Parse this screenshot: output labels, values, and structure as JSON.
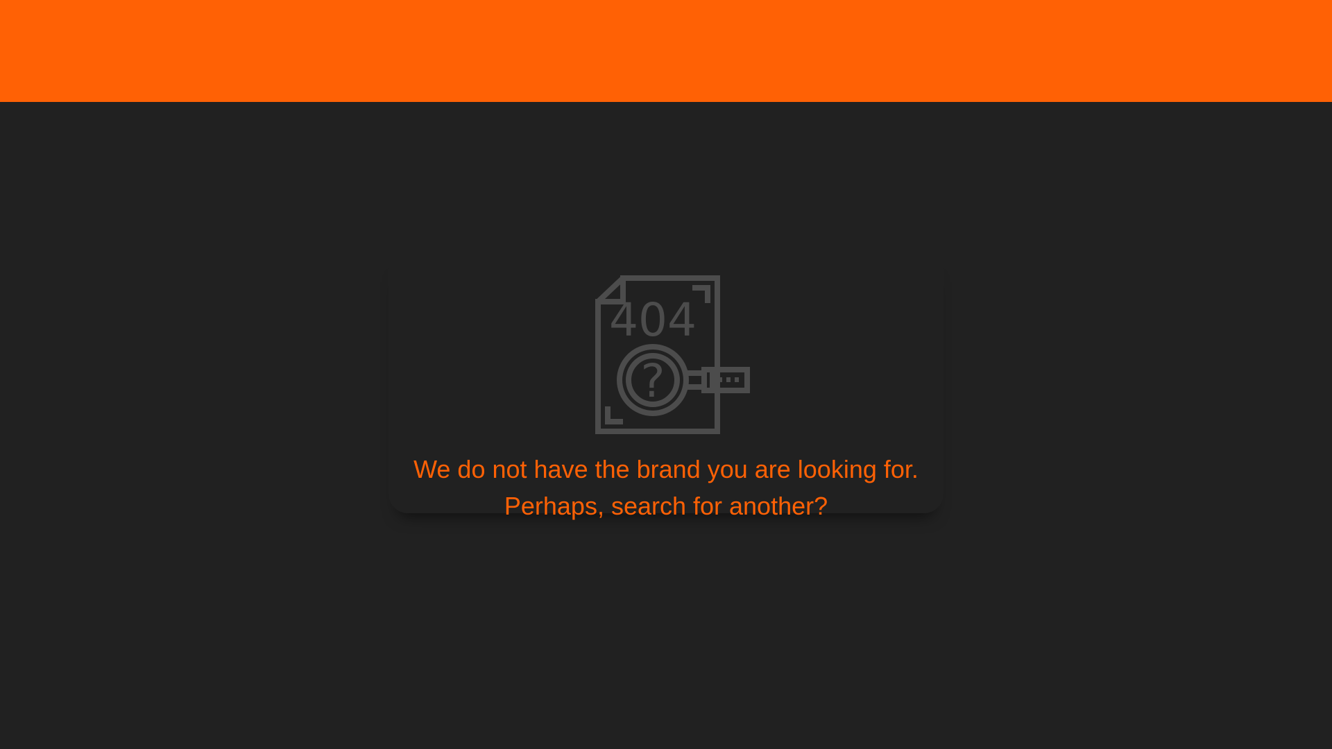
{
  "theme": {
    "accent": "#ff6105",
    "background": "#212121",
    "icon": "#4c4c4c"
  },
  "illustration": {
    "icon": "404-document-magnifier-icon",
    "code": "404",
    "symbol": "?"
  },
  "message": {
    "line1": "We do not have the brand you are looking for.",
    "line2": "Perhaps, search for another?"
  }
}
